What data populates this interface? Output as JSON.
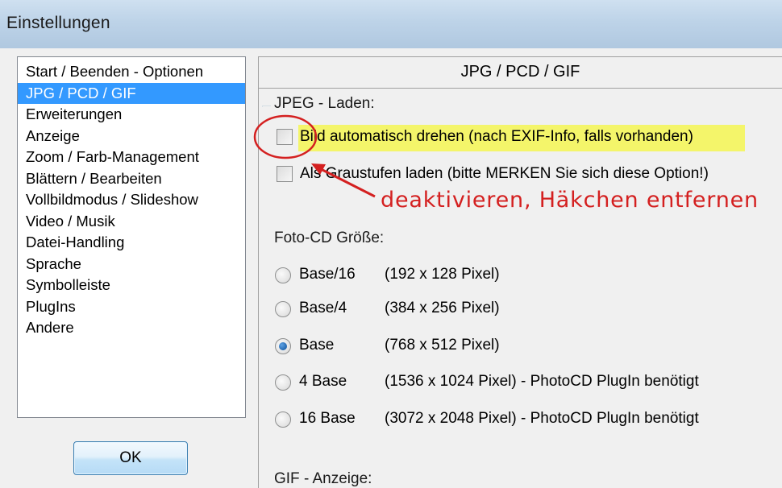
{
  "window": {
    "title": "Einstellungen"
  },
  "sidebar": {
    "items": [
      {
        "label": "Start / Beenden - Optionen",
        "selected": false
      },
      {
        "label": "JPG / PCD / GIF",
        "selected": true
      },
      {
        "label": "Erweiterungen",
        "selected": false
      },
      {
        "label": "Anzeige",
        "selected": false
      },
      {
        "label": "Zoom / Farb-Management",
        "selected": false
      },
      {
        "label": "Blättern / Bearbeiten",
        "selected": false
      },
      {
        "label": "Vollbildmodus / Slideshow",
        "selected": false
      },
      {
        "label": "Video / Musik",
        "selected": false
      },
      {
        "label": "Datei-Handling",
        "selected": false
      },
      {
        "label": "Sprache",
        "selected": false
      },
      {
        "label": "Symbolleiste",
        "selected": false
      },
      {
        "label": "PlugIns",
        "selected": false
      },
      {
        "label": "Andere",
        "selected": false
      }
    ]
  },
  "ok_button": {
    "label": "OK"
  },
  "panel": {
    "title": "JPG / PCD / GIF",
    "jpeg": {
      "label": "JPEG - Laden:",
      "auto_rotate": {
        "label": "Bild automatisch drehen (nach EXIF-Info, falls vorhanden)",
        "checked": false
      },
      "grayscale": {
        "label": "Als Graustufen laden (bitte MERKEN Sie sich diese Option!)",
        "checked": false
      }
    },
    "photocd": {
      "label": "Foto-CD Größe:",
      "options": [
        {
          "name": "Base/16",
          "desc": "(192 x 128 Pixel)",
          "checked": false
        },
        {
          "name": "Base/4",
          "desc": "(384 x 256 Pixel)",
          "checked": false
        },
        {
          "name": "Base",
          "desc": "(768 x 512 Pixel)",
          "checked": true
        },
        {
          "name": "4 Base",
          "desc": "(1536 x 1024 Pixel) - PhotoCD PlugIn benötigt",
          "checked": false
        },
        {
          "name": "16 Base",
          "desc": "(3072 x 2048 Pixel) - PhotoCD PlugIn benötigt",
          "checked": false
        }
      ]
    },
    "gif": {
      "label": "GIF - Anzeige:"
    }
  },
  "annotation": {
    "text": "deaktivieren, Häkchen entfernen",
    "color": "#d42020",
    "highlight_color": "#f4f56a"
  }
}
